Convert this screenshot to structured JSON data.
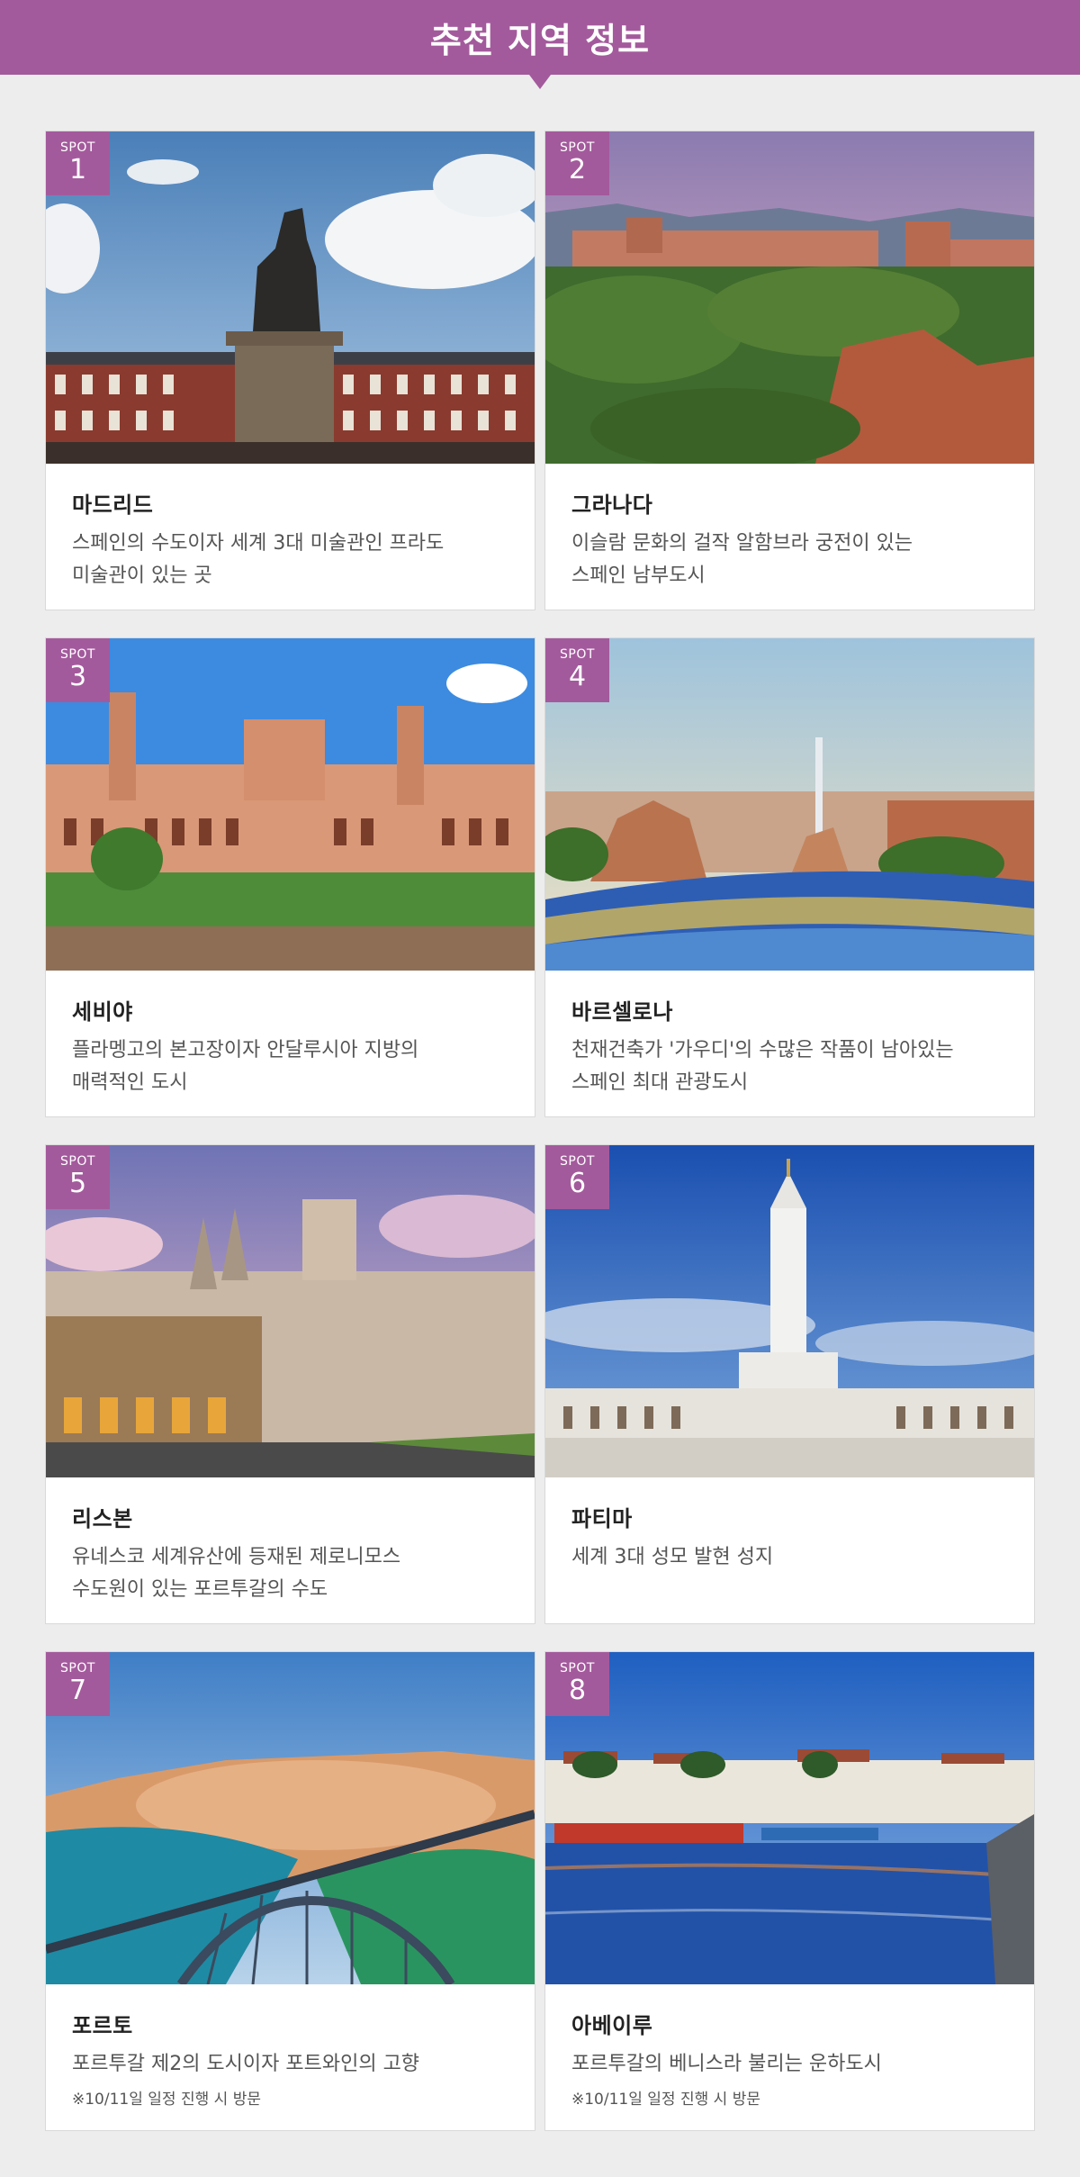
{
  "header": {
    "title": "추천 지역 정보"
  },
  "spot_label": "SPOT",
  "cards": [
    {
      "num": "1",
      "title": "마드리드",
      "desc": [
        "스페인의 수도이자 세계 3대 미술관인 프라도",
        "미술관이 있는 곳"
      ],
      "note": ""
    },
    {
      "num": "2",
      "title": "그라나다",
      "desc": [
        "이슬람 문화의 걸작 알함브라 궁전이 있는",
        "스페인 남부도시"
      ],
      "note": ""
    },
    {
      "num": "3",
      "title": "세비야",
      "desc": [
        "플라멩고의 본고장이자 안달루시아 지방의",
        "매력적인 도시"
      ],
      "note": ""
    },
    {
      "num": "4",
      "title": "바르셀로나",
      "desc": [
        "천재건축가 '가우디'의 수많은 작품이 남아있는",
        "스페인 최대 관광도시"
      ],
      "note": ""
    },
    {
      "num": "5",
      "title": "리스본",
      "desc": [
        "유네스코 세계유산에 등재된 제로니모스",
        "수도원이 있는 포르투갈의 수도"
      ],
      "note": ""
    },
    {
      "num": "6",
      "title": "파티마",
      "desc": [
        "세계 3대 성모 발현 성지",
        ""
      ],
      "note": ""
    },
    {
      "num": "7",
      "title": "포르토",
      "desc": [
        "포르투갈 제2의 도시이자 포트와인의 고향",
        ""
      ],
      "note": "※10/11일 일정 진행 시 방문"
    },
    {
      "num": "8",
      "title": "아베이루",
      "desc": [
        "포르투갈의 베니스라 불리는 운하도시",
        ""
      ],
      "note": "※10/11일 일정 진행 시 방문"
    }
  ],
  "colors": {
    "accent": "#a35a9c",
    "background": "#ededed"
  }
}
